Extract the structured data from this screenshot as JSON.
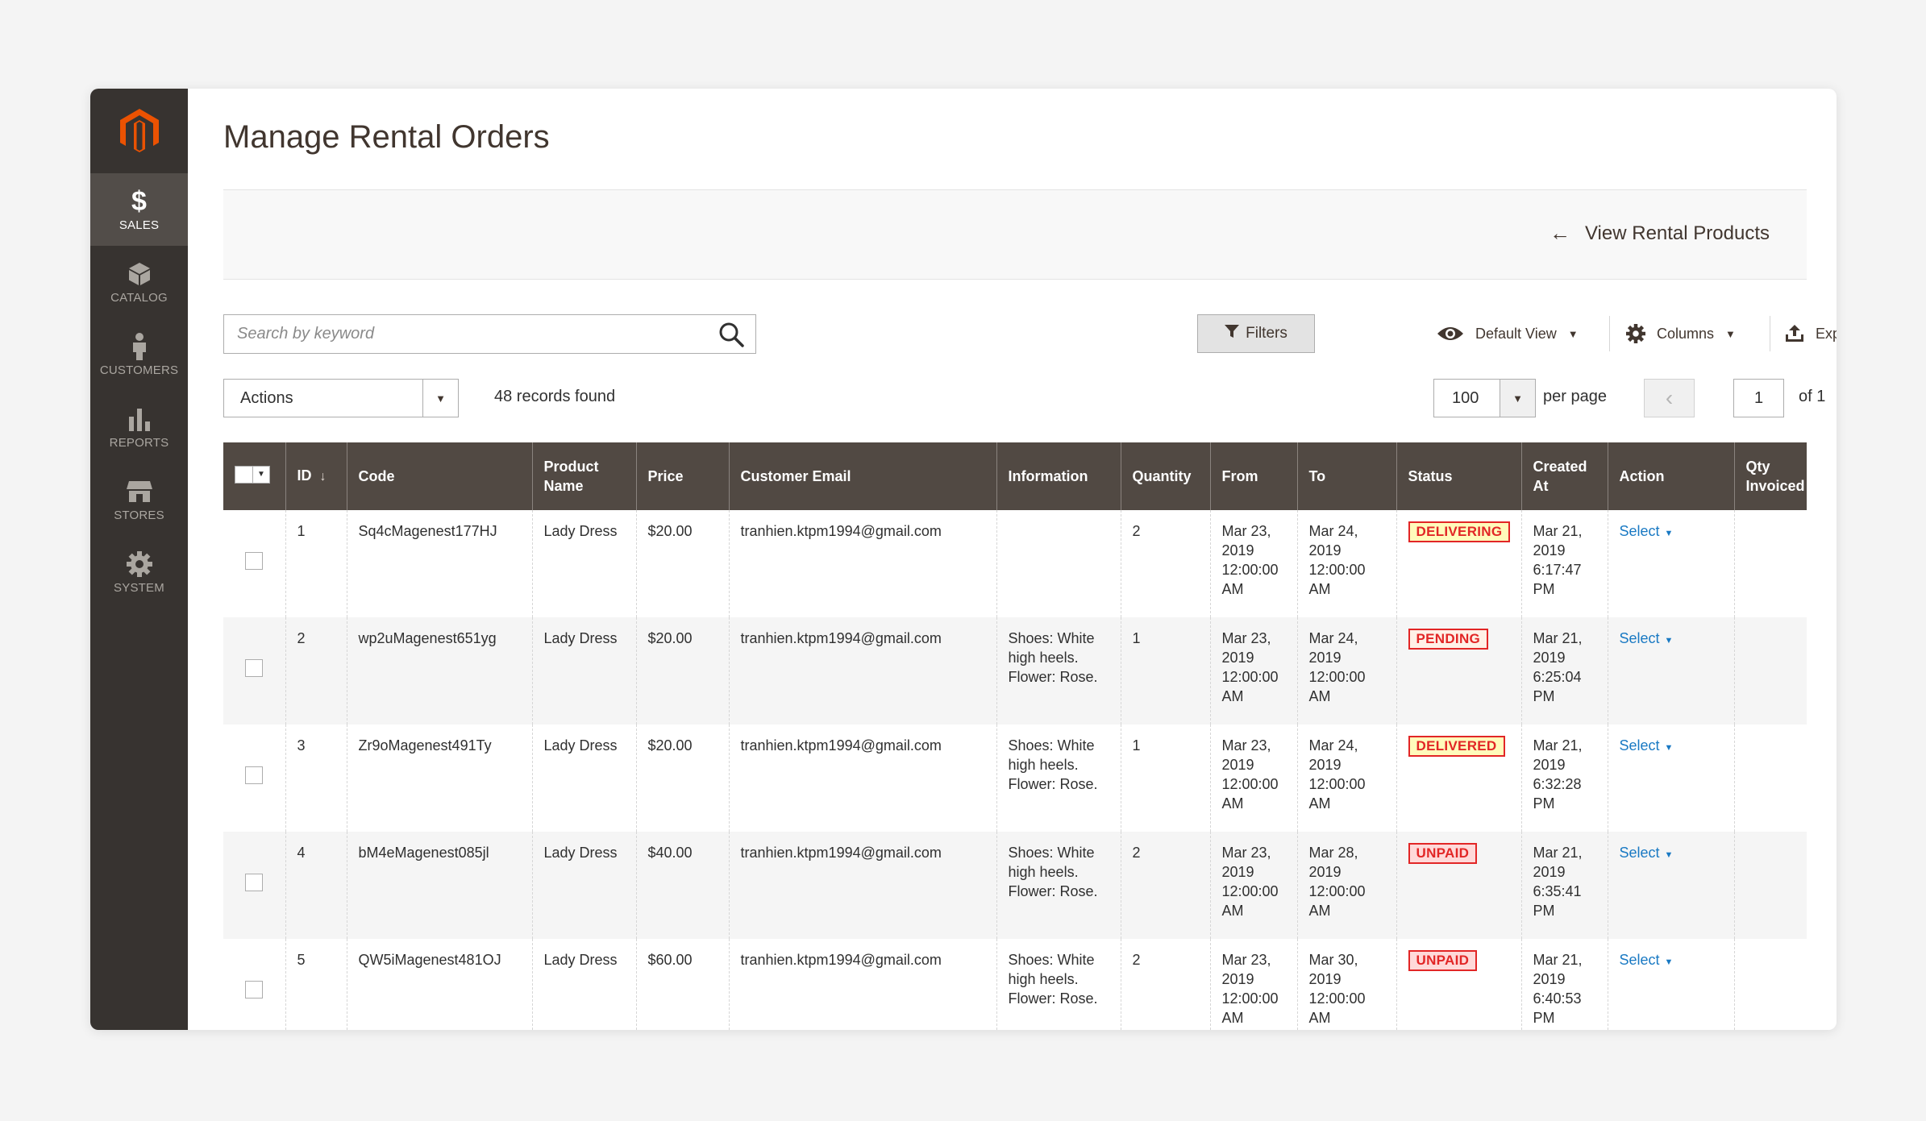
{
  "page": {
    "title": "Manage Rental Orders"
  },
  "sidebar": {
    "items": [
      {
        "label": "SALES",
        "icon": "dollar-icon",
        "active": true
      },
      {
        "label": "CATALOG",
        "icon": "cube-icon"
      },
      {
        "label": "CUSTOMERS",
        "icon": "person-icon"
      },
      {
        "label": "REPORTS",
        "icon": "bar-chart-icon"
      },
      {
        "label": "STORES",
        "icon": "store-icon"
      },
      {
        "label": "SYSTEM",
        "icon": "gear-icon"
      }
    ]
  },
  "action_bar": {
    "back_label": "View Rental Products"
  },
  "toolbar": {
    "search_placeholder": "Search by keyword",
    "filters_label": "Filters",
    "view_label": "Default View",
    "columns_label": "Columns",
    "export_label": "Export",
    "actions_label": "Actions",
    "records_found": "48 records found",
    "per_page_value": "100",
    "per_page_label": "per page",
    "page_current": "1",
    "page_of": "of 1"
  },
  "grid": {
    "headers": {
      "id": "ID",
      "code": "Code",
      "product_name": "Product Name",
      "price": "Price",
      "customer_email": "Customer Email",
      "information": "Information",
      "quantity": "Quantity",
      "from": "From",
      "to": "To",
      "status": "Status",
      "created_at": "Created At",
      "action": "Action",
      "qty_invoiced": "Qty Invoiced"
    },
    "rows": [
      {
        "id": "1",
        "code": "Sq4cMagenest177HJ",
        "product": "Lady Dress",
        "price": "$20.00",
        "email": "tranhien.ktpm1994@gmail.com",
        "info": "",
        "qty": "2",
        "from": "Mar 23, 2019 12:00:00 AM",
        "to": "Mar 24, 2019 12:00:00 AM",
        "status": "DELIVERING",
        "created": "Mar 21, 2019 6:17:47 PM",
        "action": "Select"
      },
      {
        "id": "2",
        "code": "wp2uMagenest651yg",
        "product": "Lady Dress",
        "price": "$20.00",
        "email": "tranhien.ktpm1994@gmail.com",
        "info": "Shoes: White high heels. Flower: Rose.",
        "qty": "1",
        "from": "Mar 23, 2019 12:00:00 AM",
        "to": "Mar 24, 2019 12:00:00 AM",
        "status": "PENDING",
        "created": "Mar 21, 2019 6:25:04 PM",
        "action": "Select"
      },
      {
        "id": "3",
        "code": "Zr9oMagenest491Ty",
        "product": "Lady Dress",
        "price": "$20.00",
        "email": "tranhien.ktpm1994@gmail.com",
        "info": "Shoes: White high heels. Flower: Rose.",
        "qty": "1",
        "from": "Mar 23, 2019 12:00:00 AM",
        "to": "Mar 24, 2019 12:00:00 AM",
        "status": "DELIVERED",
        "created": "Mar 21, 2019 6:32:28 PM",
        "action": "Select"
      },
      {
        "id": "4",
        "code": "bM4eMagenest085jl",
        "product": "Lady Dress",
        "price": "$40.00",
        "email": "tranhien.ktpm1994@gmail.com",
        "info": "Shoes: White high heels. Flower: Rose.",
        "qty": "2",
        "from": "Mar 23, 2019 12:00:00 AM",
        "to": "Mar 28, 2019 12:00:00 AM",
        "status": "UNPAID",
        "created": "Mar 21, 2019 6:35:41 PM",
        "action": "Select"
      },
      {
        "id": "5",
        "code": "QW5iMagenest481OJ",
        "product": "Lady Dress",
        "price": "$60.00",
        "email": "tranhien.ktpm1994@gmail.com",
        "info": "Shoes: White high heels. Flower: Rose.",
        "qty": "2",
        "from": "Mar 23, 2019 12:00:00 AM",
        "to": "Mar 30, 2019 12:00:00 AM",
        "status": "UNPAID",
        "created": "Mar 21, 2019 6:40:53 PM",
        "action": "Select"
      }
    ]
  },
  "colors": {
    "sidebar_bg": "#373330",
    "sidebar_active": "#524d49",
    "header_bg": "#514943",
    "logo_orange": "#eb5202",
    "link_blue": "#1979c3",
    "status_red": "#e22626"
  }
}
